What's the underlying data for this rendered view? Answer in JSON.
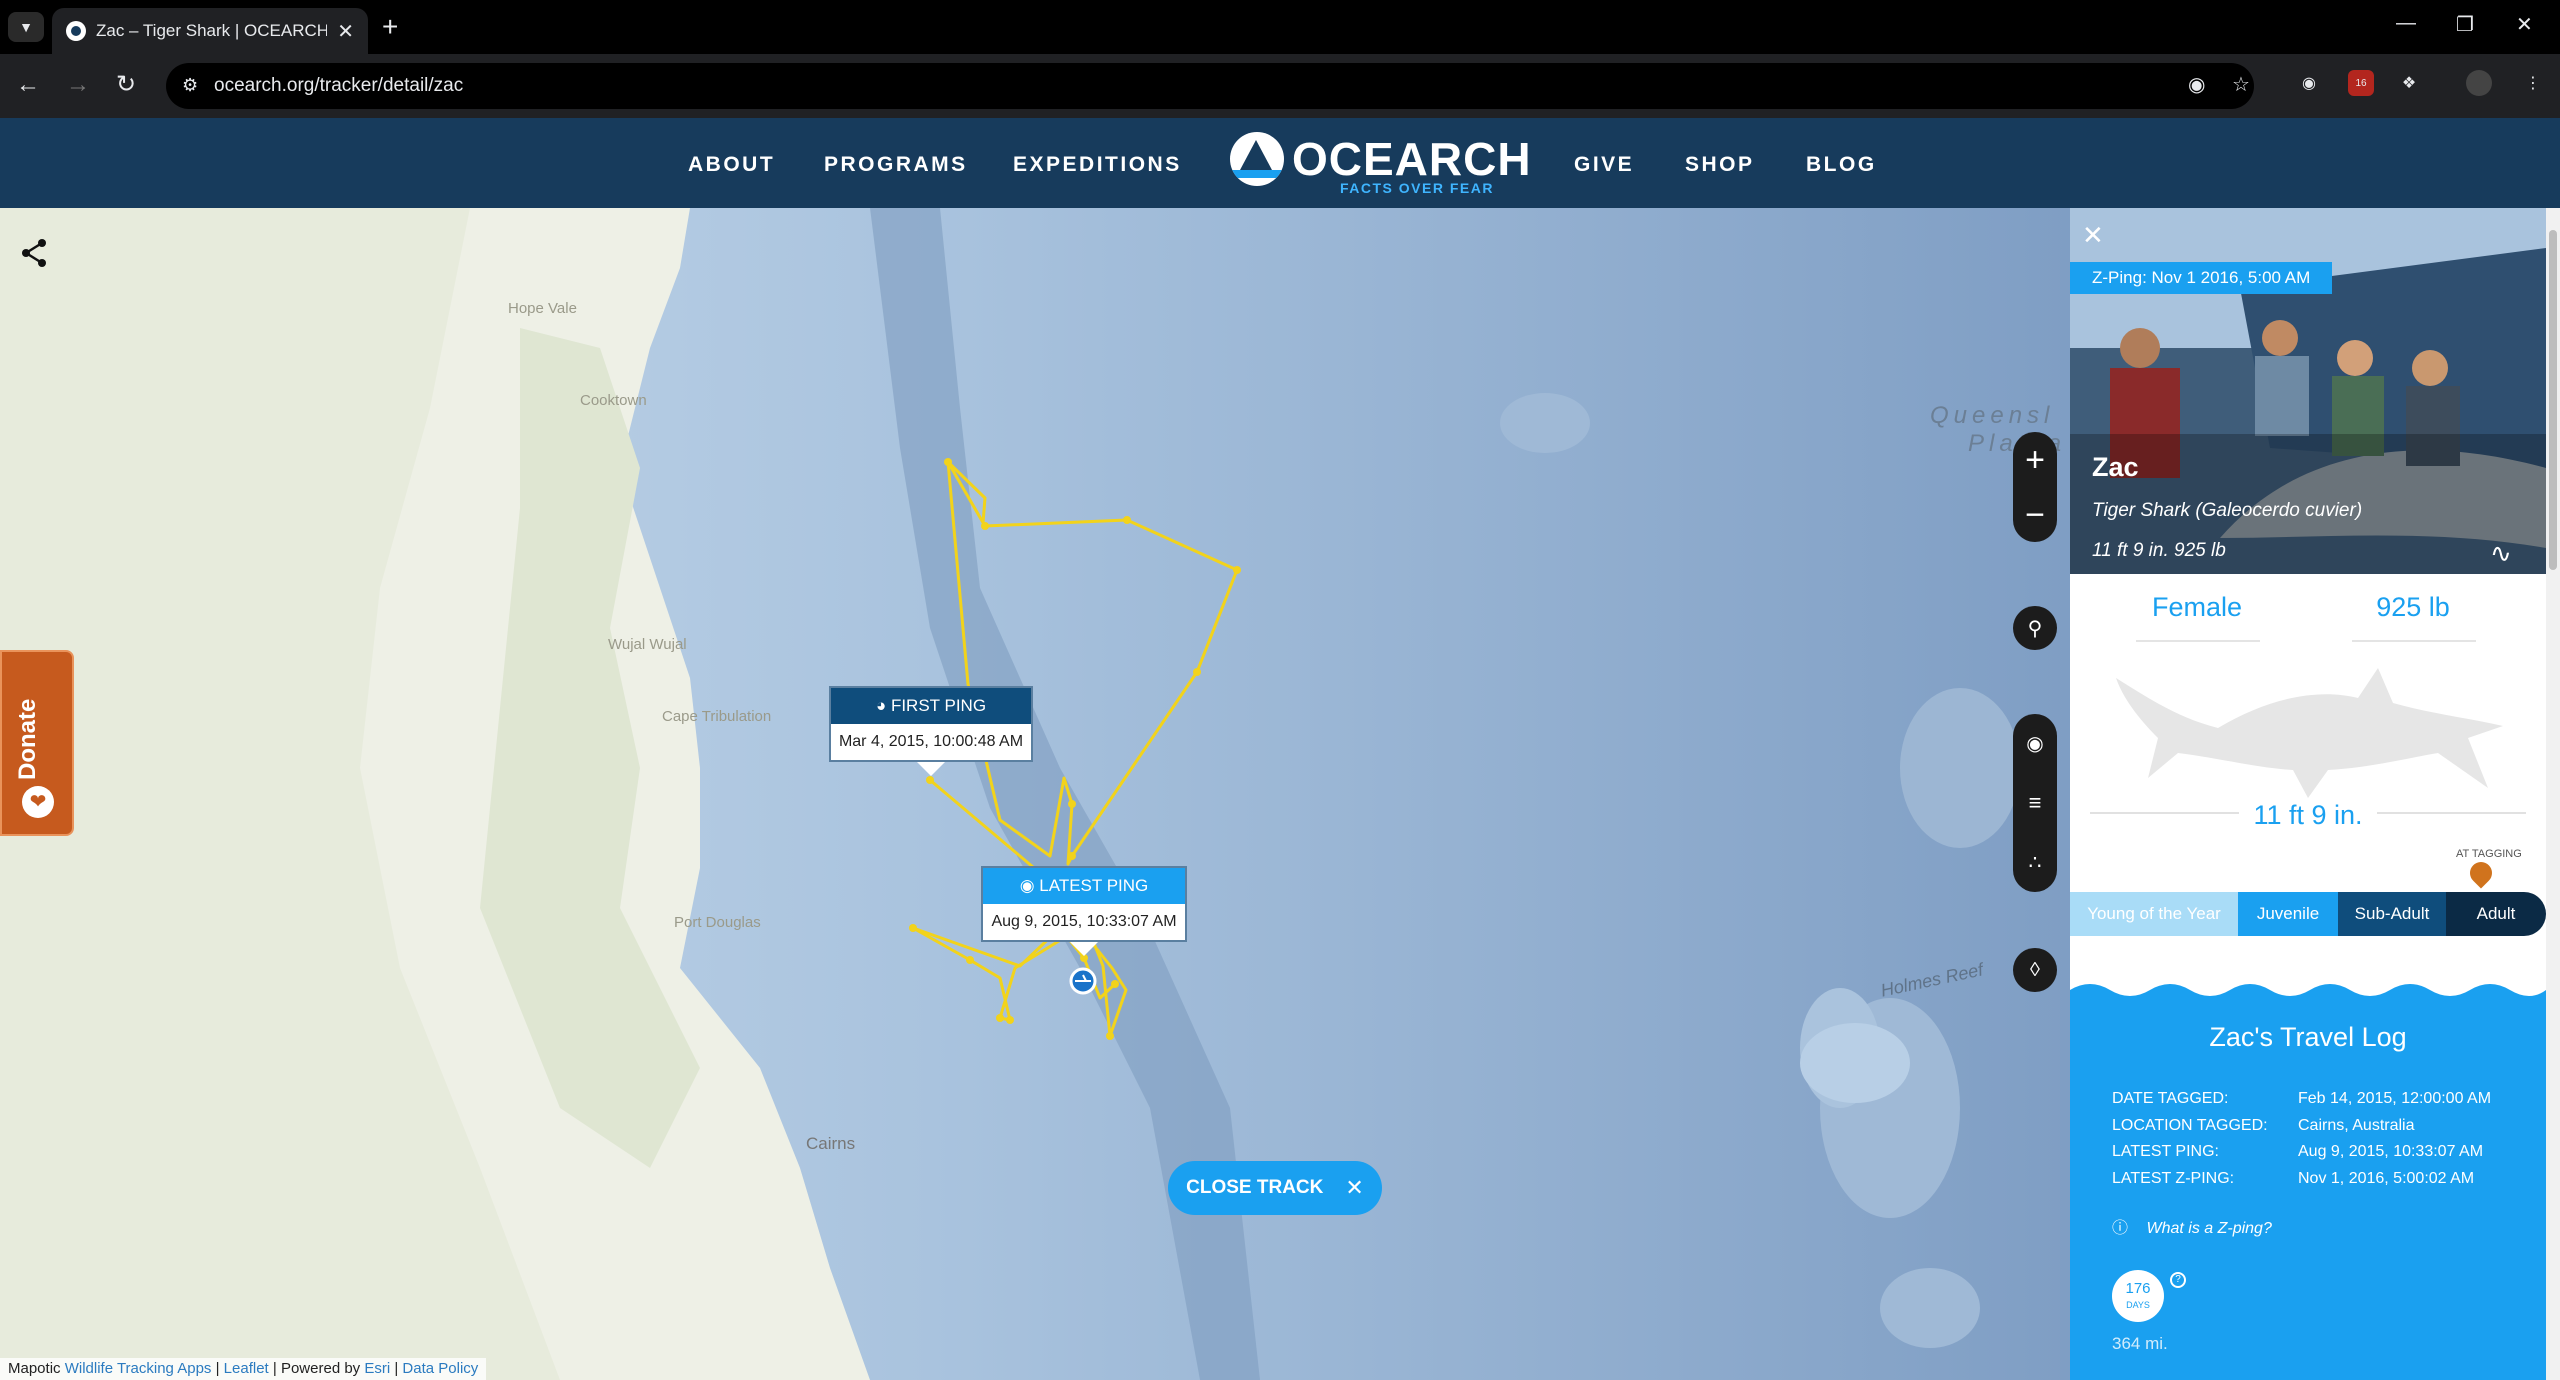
{
  "browser": {
    "tab_title": "Zac – Tiger Shark | OCEARCH Shark Tracker",
    "url": "ocearch.org/tracker/detail/zac",
    "extension_badge": "16"
  },
  "header": {
    "nav_left": [
      "ABOUT",
      "PROGRAMS",
      "EXPEDITIONS"
    ],
    "nav_right": [
      "GIVE",
      "SHOP",
      "BLOG"
    ],
    "logo_text": "OCEARCH",
    "logo_tagline": "FACTS OVER FEAR"
  },
  "map": {
    "labels": {
      "hope_vale": "Hope Vale",
      "cooktown": "Cooktown",
      "wujal_wujal": "Wujal Wujal",
      "cape_tribulation": "Cape Tribulation",
      "port_douglas": "Port Douglas",
      "cairns": "Cairns",
      "queensland_plateau_1": "Queensl",
      "queensland_plateau_2": "Platea",
      "holmes_reef": "Holmes Reef"
    },
    "donate_label": "Donate",
    "first_ping": {
      "label": "FIRST PING",
      "date": "Mar 4, 2015, 10:00:48 AM"
    },
    "latest_ping": {
      "label": "LATEST PING",
      "date": "Aug 9, 2015, 10:33:07 AM"
    },
    "close_track_label": "CLOSE TRACK",
    "attribution": {
      "mapotic": "Mapotic",
      "wildlife_link": "Wildlife Tracking Apps",
      "leaflet": "Leaflet",
      "powered_by": "Powered by",
      "esri": "Esri",
      "data_policy": "Data Policy"
    },
    "track_color": "#f2d31b"
  },
  "panel": {
    "zping_badge": "Z-Ping: Nov 1 2016, 5:00 AM",
    "name": "Zac",
    "species": "Tiger Shark (Galeocerdo cuvier)",
    "size_line": "11 ft 9 in. 925 lb",
    "gender": "Female",
    "weight": "925 lb",
    "length": "11 ft 9 in.",
    "at_tagging": "AT TAGGING",
    "stages": [
      "Young of the Year",
      "Juvenile",
      "Sub-Adult",
      "Adult"
    ],
    "current_stage": "Adult",
    "log_title": "Zac's Travel Log",
    "log": [
      {
        "label": "DATE TAGGED:",
        "value": "Feb 14, 2015, 12:00:00 AM"
      },
      {
        "label": "LOCATION TAGGED:",
        "value": "Cairns, Australia"
      },
      {
        "label": "LATEST PING:",
        "value": "Aug 9, 2015, 10:33:07 AM"
      },
      {
        "label": "LATEST Z-PING:",
        "value": "Nov 1, 2016, 5:00:02 AM"
      }
    ],
    "zping_help": "What is a Z-ping?",
    "days": "176",
    "days_unit": "DAYS",
    "distance": "364 mi.",
    "accent_color": "#1aa0f0",
    "stage_colors": [
      "#a9dcf7",
      "#1aa0f0",
      "#0f4d7c",
      "#0b2a45"
    ]
  }
}
